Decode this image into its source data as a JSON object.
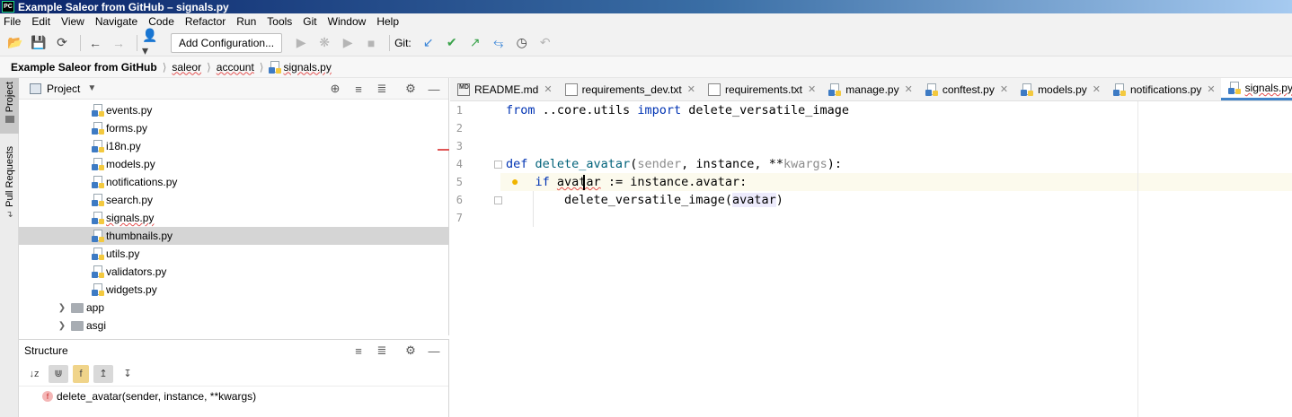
{
  "window": {
    "title": "Example Saleor from GitHub – signals.py"
  },
  "menu": [
    "File",
    "Edit",
    "View",
    "Navigate",
    "Code",
    "Refactor",
    "Run",
    "Tools",
    "Git",
    "Window",
    "Help"
  ],
  "toolbar": {
    "run_config_label": "Add Configuration...",
    "git_label": "Git:"
  },
  "breadcrumb": [
    "Example Saleor from GitHub",
    "saleor",
    "account",
    "signals.py"
  ],
  "left_strip": {
    "project_tab": "Project",
    "pull_requests_tab": "Pull Requests"
  },
  "project_panel": {
    "title": "Project",
    "files": [
      "events.py",
      "forms.py",
      "i18n.py",
      "models.py",
      "notifications.py",
      "search.py",
      "signals.py",
      "thumbnails.py",
      "utils.py",
      "validators.py",
      "widgets.py"
    ],
    "selected_file": "thumbnails.py",
    "folders": [
      "app",
      "asgi"
    ]
  },
  "structure_panel": {
    "title": "Structure",
    "item": "delete_avatar(sender, instance, **kwargs)",
    "item_badge": "f"
  },
  "tabs": [
    "README.md",
    "requirements_dev.txt",
    "requirements.txt",
    "manage.py",
    "conftest.py",
    "models.py",
    "notifications.py",
    "signals.py"
  ],
  "active_tab": "signals.py",
  "tab_icon_badge": "MD",
  "editor": {
    "line_numbers": [
      "1",
      "2",
      "3",
      "4",
      "5",
      "6",
      "7"
    ],
    "line1": {
      "kw_from": "from",
      "module": " ..core.utils ",
      "kw_import": "import",
      "name": " delete_versatile_image"
    },
    "line4": {
      "kw_def": "def",
      "fn": "delete_avatar",
      "p1": "(",
      "sender": "sender",
      "sep1": ", ",
      "instance": "instance",
      "sep2": ", ",
      "stars": "**",
      "kwargs": "kwargs",
      "end": "):"
    },
    "line5": {
      "indent": "    ",
      "kw_if": "if",
      "sp": " ",
      "var": "avatar",
      "rest": " := instance.avatar:"
    },
    "line6": {
      "indent": "        ",
      "call": "delete_versatile_image(",
      "arg": "avatar",
      "close": ")"
    }
  },
  "colors": {
    "keyword": "#0033b3",
    "function": "#00627a",
    "active_tab_underline": "#4083c9",
    "selection": "#d5d5d5",
    "current_line": "#fcfaed"
  }
}
